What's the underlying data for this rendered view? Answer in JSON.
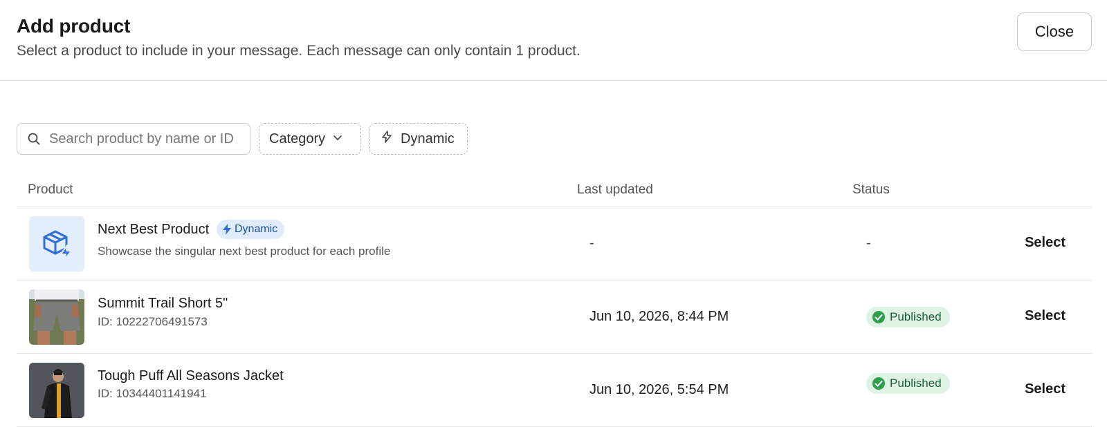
{
  "header": {
    "title": "Add product",
    "subtitle": "Select a product to include in your message. Each message can only contain 1 product.",
    "close_label": "Close"
  },
  "toolbar": {
    "search_placeholder": "Search product by name or ID",
    "category_label": "Category",
    "dynamic_label": "Dynamic"
  },
  "table": {
    "columns": {
      "product": "Product",
      "last_updated": "Last updated",
      "status": "Status"
    },
    "rows": [
      {
        "name": "Next Best Product",
        "badge": "Dynamic",
        "description": "Showcase the singular next best product for each profile",
        "last_updated": "-",
        "status": "-",
        "action": "Select",
        "thumbnail": "dynamic-product-icon"
      },
      {
        "name": "Summit Trail Short 5\"",
        "description": "ID: 10222706491573",
        "last_updated": "Jun 10, 2026, 8:44 PM",
        "status": "Published",
        "action": "Select",
        "thumbnail": "shorts-photo"
      },
      {
        "name": "Tough Puff All Seasons Jacket",
        "description": "ID: 10344401141941",
        "last_updated": "Jun 10, 2026, 5:54 PM",
        "status": "Published",
        "action": "Select",
        "thumbnail": "jacket-photo"
      }
    ]
  },
  "colors": {
    "published_bg": "#dff3e4",
    "published_icon": "#2e9e4f",
    "dynamic_bg": "#e0ecfb",
    "dynamic_accent": "#2f6fd6",
    "border": "#e4e4e4"
  }
}
